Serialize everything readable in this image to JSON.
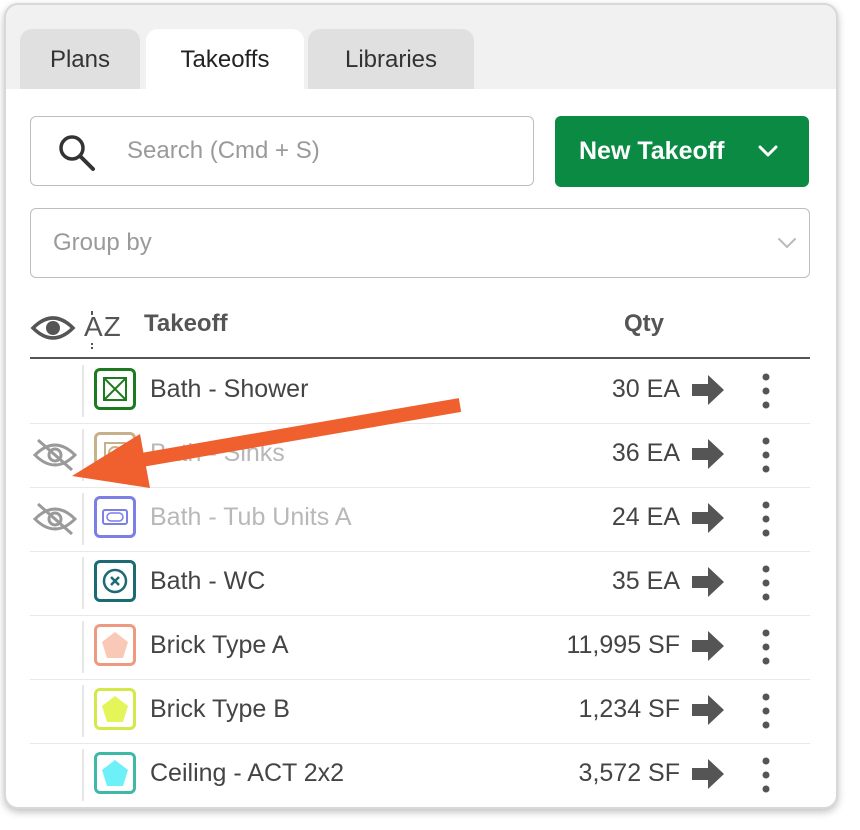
{
  "tabs": [
    {
      "label": "Plans",
      "active": false
    },
    {
      "label": "Takeoffs",
      "active": true
    },
    {
      "label": "Libraries",
      "active": false
    }
  ],
  "search": {
    "placeholder": "Search (Cmd + S)",
    "value": ""
  },
  "new_takeoff": {
    "label": "New Takeoff",
    "color": "#0b8a43"
  },
  "group_by": {
    "placeholder": "Group by"
  },
  "table": {
    "col_takeoff": "Takeoff",
    "col_qty": "Qty",
    "sort_label": "AZ",
    "rows": [
      {
        "name": "Bath - Shower",
        "qty": "30 EA",
        "hidden": false,
        "swatch": "#1e7a1e",
        "icon": "crossed-box-icon"
      },
      {
        "name": "Bath - Sinks",
        "qty": "36 EA",
        "hidden": true,
        "swatch": "#c8b08a",
        "icon": "sink-icon"
      },
      {
        "name": "Bath - Tub Units A",
        "qty": "24 EA",
        "hidden": true,
        "swatch": "#7b7fe6",
        "icon": "tub-icon"
      },
      {
        "name": "Bath - WC",
        "qty": "35 EA",
        "hidden": false,
        "swatch": "#1a6b73",
        "icon": "circle-x-icon"
      },
      {
        "name": "Brick Type A",
        "qty": "11,995 SF",
        "hidden": false,
        "swatch": "#ee9a80",
        "icon": "pentagon-icon",
        "fill": "#f9c8b6"
      },
      {
        "name": "Brick Type B",
        "qty": "1,234 SF",
        "hidden": false,
        "swatch": "#d4e84a",
        "icon": "pentagon-icon",
        "fill": "#e4f55a"
      },
      {
        "name": "Ceiling - ACT 2x2",
        "qty": "3,572 SF",
        "hidden": false,
        "swatch": "#3fb9a5",
        "icon": "pentagon-icon",
        "fill": "#6ef0f8"
      }
    ]
  },
  "annotation": {
    "color": "#f05f2e",
    "icon": "callout-arrow"
  }
}
